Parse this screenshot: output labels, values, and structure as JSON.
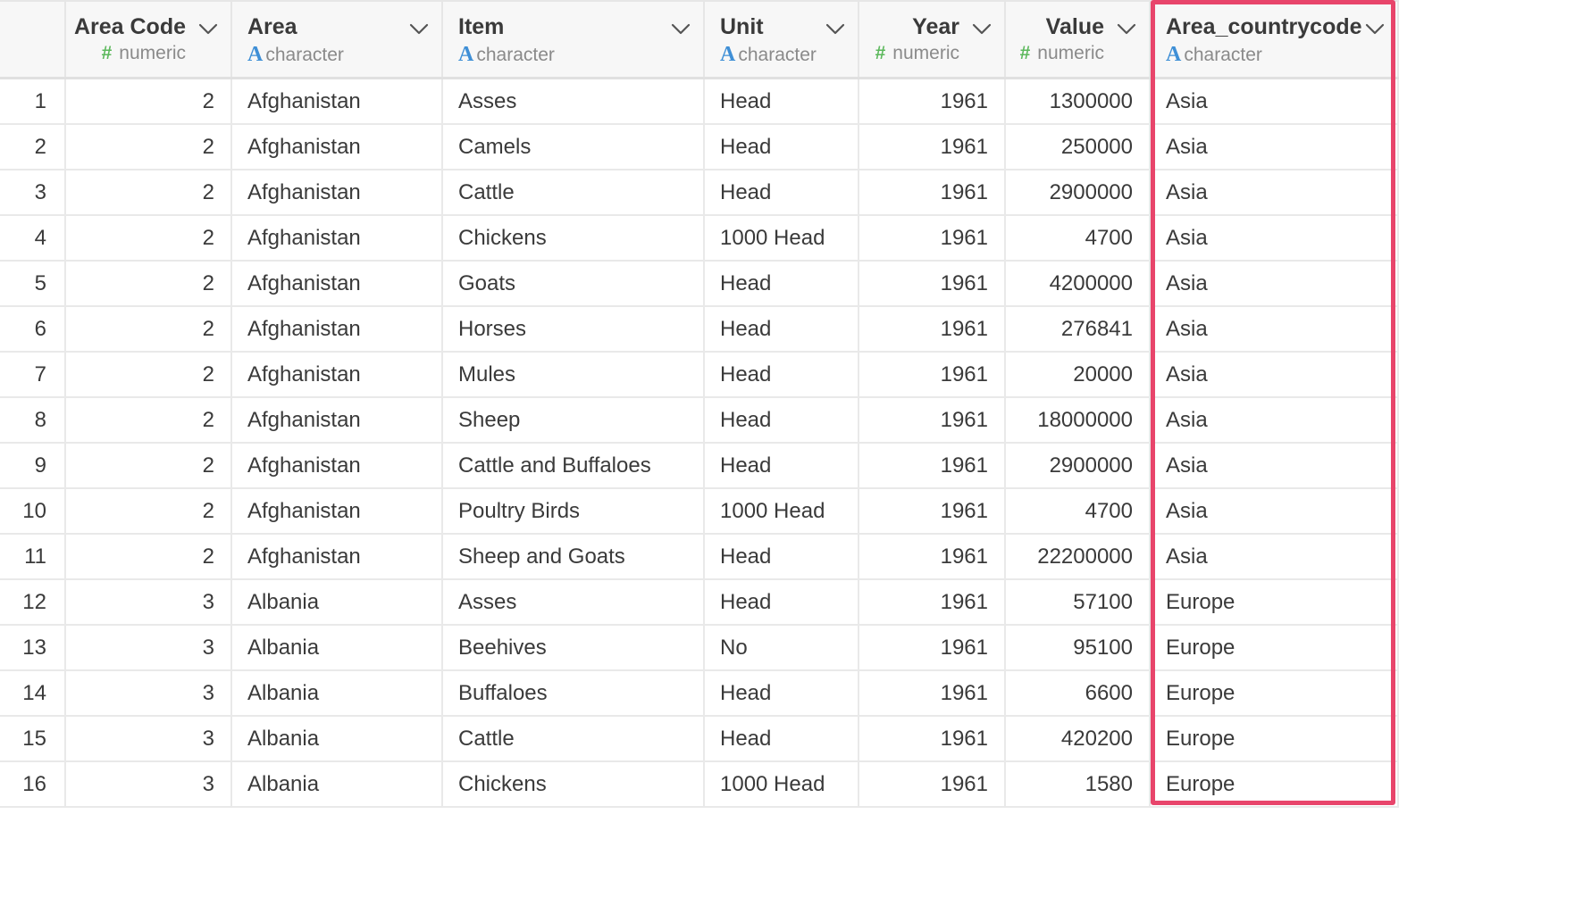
{
  "columns": [
    {
      "key": "area_code",
      "name": "Area Code",
      "type": "numeric",
      "type_icon": "numeric-type-icon"
    },
    {
      "key": "area",
      "name": "Area",
      "type": "character",
      "type_icon": "character-type-icon"
    },
    {
      "key": "item",
      "name": "Item",
      "type": "character",
      "type_icon": "character-type-icon"
    },
    {
      "key": "unit",
      "name": "Unit",
      "type": "character",
      "type_icon": "character-type-icon"
    },
    {
      "key": "year",
      "name": "Year",
      "type": "numeric",
      "type_icon": "numeric-type-icon"
    },
    {
      "key": "value",
      "name": "Value",
      "type": "numeric",
      "type_icon": "numeric-type-icon"
    },
    {
      "key": "area_countrycode",
      "name": "Area_countrycode",
      "type": "character",
      "type_icon": "character-type-icon"
    }
  ],
  "type_glyphs": {
    "numeric": "#",
    "character": "A"
  },
  "rows": [
    {
      "index": "1",
      "area_code": "2",
      "area": "Afghanistan",
      "item": "Asses",
      "unit": "Head",
      "year": "1961",
      "value": "1300000",
      "area_countrycode": "Asia"
    },
    {
      "index": "2",
      "area_code": "2",
      "area": "Afghanistan",
      "item": "Camels",
      "unit": "Head",
      "year": "1961",
      "value": "250000",
      "area_countrycode": "Asia"
    },
    {
      "index": "3",
      "area_code": "2",
      "area": "Afghanistan",
      "item": "Cattle",
      "unit": "Head",
      "year": "1961",
      "value": "2900000",
      "area_countrycode": "Asia"
    },
    {
      "index": "4",
      "area_code": "2",
      "area": "Afghanistan",
      "item": "Chickens",
      "unit": "1000 Head",
      "year": "1961",
      "value": "4700",
      "area_countrycode": "Asia"
    },
    {
      "index": "5",
      "area_code": "2",
      "area": "Afghanistan",
      "item": "Goats",
      "unit": "Head",
      "year": "1961",
      "value": "4200000",
      "area_countrycode": "Asia"
    },
    {
      "index": "6",
      "area_code": "2",
      "area": "Afghanistan",
      "item": "Horses",
      "unit": "Head",
      "year": "1961",
      "value": "276841",
      "area_countrycode": "Asia"
    },
    {
      "index": "7",
      "area_code": "2",
      "area": "Afghanistan",
      "item": "Mules",
      "unit": "Head",
      "year": "1961",
      "value": "20000",
      "area_countrycode": "Asia"
    },
    {
      "index": "8",
      "area_code": "2",
      "area": "Afghanistan",
      "item": "Sheep",
      "unit": "Head",
      "year": "1961",
      "value": "18000000",
      "area_countrycode": "Asia"
    },
    {
      "index": "9",
      "area_code": "2",
      "area": "Afghanistan",
      "item": "Cattle and Buffaloes",
      "unit": "Head",
      "year": "1961",
      "value": "2900000",
      "area_countrycode": "Asia"
    },
    {
      "index": "10",
      "area_code": "2",
      "area": "Afghanistan",
      "item": "Poultry Birds",
      "unit": "1000 Head",
      "year": "1961",
      "value": "4700",
      "area_countrycode": "Asia"
    },
    {
      "index": "11",
      "area_code": "2",
      "area": "Afghanistan",
      "item": "Sheep and Goats",
      "unit": "Head",
      "year": "1961",
      "value": "22200000",
      "area_countrycode": "Asia"
    },
    {
      "index": "12",
      "area_code": "3",
      "area": "Albania",
      "item": "Asses",
      "unit": "Head",
      "year": "1961",
      "value": "57100",
      "area_countrycode": "Europe"
    },
    {
      "index": "13",
      "area_code": "3",
      "area": "Albania",
      "item": "Beehives",
      "unit": "No",
      "year": "1961",
      "value": "95100",
      "area_countrycode": "Europe"
    },
    {
      "index": "14",
      "area_code": "3",
      "area": "Albania",
      "item": "Buffaloes",
      "unit": "Head",
      "year": "1961",
      "value": "6600",
      "area_countrycode": "Europe"
    },
    {
      "index": "15",
      "area_code": "3",
      "area": "Albania",
      "item": "Cattle",
      "unit": "Head",
      "year": "1961",
      "value": "420200",
      "area_countrycode": "Europe"
    },
    {
      "index": "16",
      "area_code": "3",
      "area": "Albania",
      "item": "Chickens",
      "unit": "1000 Head",
      "year": "1961",
      "value": "1580",
      "area_countrycode": "Europe"
    }
  ],
  "colors": {
    "highlight_border": "#e8456b",
    "numeric_type": "#5cb85c",
    "character_type": "#3f8fd6",
    "header_bg": "#f7f7f7",
    "grid_line": "#e9e9e9"
  },
  "highlighted_column": "Area_countrycode"
}
